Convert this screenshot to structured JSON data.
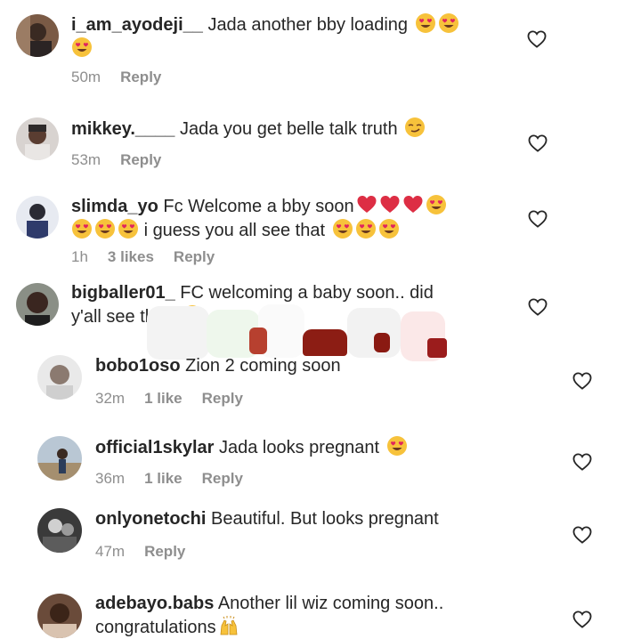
{
  "comments": [
    {
      "username": "i_am_ayodeji__",
      "text": "Jada another bby loading",
      "time": "50m",
      "reply": "Reply",
      "emojis": [
        "heart-eyes-emoji",
        "heart-eyes-emoji",
        "heart-eyes-emoji"
      ]
    },
    {
      "username": "mikkey.____",
      "text": "Jada you get belle talk truth",
      "time": "53m",
      "reply": "Reply",
      "emojis": [
        "smirk-emoji"
      ]
    },
    {
      "username": "slimda_yo",
      "text": "Fc Welcome a bby soon",
      "text2": "i guess you all see that",
      "time": "1h",
      "likes": "3 likes",
      "reply": "Reply",
      "emojis": [
        "red-heart-emoji",
        "red-heart-emoji",
        "red-heart-emoji",
        "heart-eyes-emoji",
        "heart-eyes-emoji",
        "heart-eyes-emoji",
        "heart-eyes-emoji",
        "heart-eyes-emoji",
        "heart-eyes-emoji",
        "heart-eyes-emoji"
      ]
    },
    {
      "username": "bigballer01_",
      "text": "FC welcoming a baby soon.. did",
      "text2": "y'all see that?",
      "emojis": [
        "kissing-emoji"
      ]
    }
  ],
  "replies": [
    {
      "username": "bobo1oso",
      "text": "Zion 2 coming soon",
      "time": "32m",
      "likes": "1 like",
      "reply": "Reply"
    },
    {
      "username": "official1skylar",
      "text": "Jada looks pregnant",
      "time": "36m",
      "likes": "1 like",
      "reply": "Reply",
      "emojis": [
        "heart-eyes-emoji"
      ]
    },
    {
      "username": "onlyonetochi",
      "text": "Beautiful. But looks pregnant",
      "time": "47m",
      "reply": "Reply"
    },
    {
      "username": "adebayo.babs",
      "text": "Another lil wiz coming soon..",
      "text2": "congratulations",
      "emojis": [
        "raising-hands-emoji"
      ]
    }
  ],
  "colors": {
    "text": "#262626",
    "meta": "#8e8e8e",
    "heart_outline": "#262626",
    "emoji_face": "#f7c23b",
    "emoji_heart": "#e0245e"
  }
}
